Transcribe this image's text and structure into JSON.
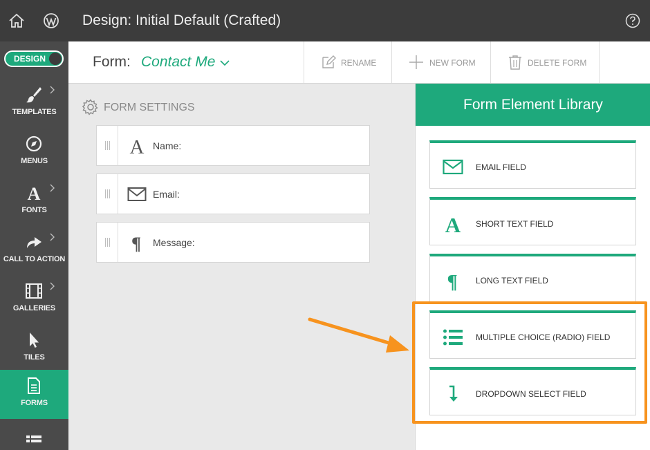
{
  "topbar": {
    "title": "Design: Initial Default (Crafted)"
  },
  "sidebar": {
    "toggle_label": "DESIGN",
    "items": [
      {
        "label": "TEMPLATES"
      },
      {
        "label": "MENUS"
      },
      {
        "label": "FONTS"
      },
      {
        "label": "CALL TO ACTION"
      },
      {
        "label": "GALLERIES"
      },
      {
        "label": "TILES"
      },
      {
        "label": "FORMS"
      }
    ]
  },
  "form_header": {
    "label": "Form:",
    "name": "Contact Me",
    "rename": "RENAME",
    "new_form": "NEW FORM",
    "delete_form": "DELETE FORM"
  },
  "form_settings": {
    "title": "FORM SETTINGS",
    "fields": [
      {
        "label": "Name:"
      },
      {
        "label": "Email:"
      },
      {
        "label": "Message:"
      }
    ]
  },
  "library": {
    "title": "Form Element Library",
    "items": [
      {
        "label": "EMAIL FIELD"
      },
      {
        "label": "SHORT TEXT FIELD"
      },
      {
        "label": "LONG TEXT FIELD"
      },
      {
        "label": "MULTIPLE CHOICE (RADIO) FIELD"
      },
      {
        "label": "DROPDOWN SELECT FIELD"
      }
    ]
  },
  "colors": {
    "accent": "#1ea97c",
    "highlight": "#f7931e",
    "topbar": "#3c3c3c",
    "sidebar": "#4a4a4a"
  }
}
